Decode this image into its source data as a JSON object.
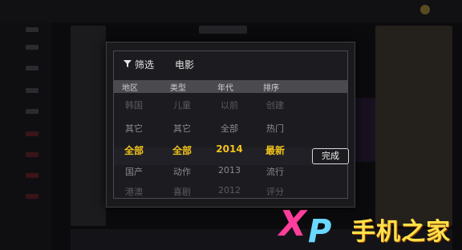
{
  "dialog": {
    "title": "筛选",
    "subtitle": "电影",
    "headers": [
      "地区",
      "类型",
      "年代",
      "排序"
    ],
    "columns": [
      [
        "韩国",
        "其它",
        "全部",
        "国产",
        "港澳"
      ],
      [
        "儿童",
        "其它",
        "全部",
        "动作",
        "喜剧"
      ],
      [
        "以前",
        "全部",
        "2014",
        "2013",
        "2012"
      ],
      [
        "创建",
        "热门",
        "最新",
        "流行",
        "评分"
      ]
    ],
    "selected_row_index": 2,
    "done_label": "完成"
  },
  "watermark": {
    "x": "X",
    "p": "P",
    "text": "手机之家"
  },
  "colors": {
    "selected": "#f2c21b",
    "watermark_pink": "#ff3e9b",
    "watermark_blue": "#6ad7ff",
    "watermark_yellow": "#ffe14a"
  }
}
